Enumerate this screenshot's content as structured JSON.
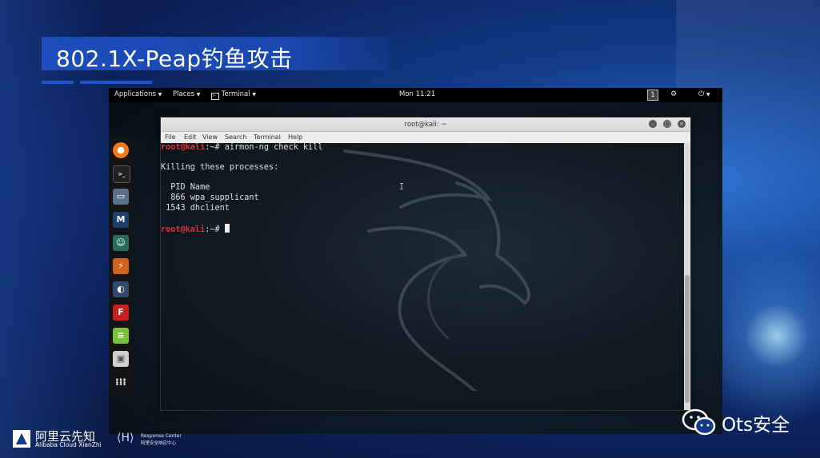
{
  "slide": {
    "title": "802.1X-Peap钓鱼攻击"
  },
  "topbar": {
    "applications": "Applications",
    "places": "Places",
    "terminal": "Terminal",
    "clock": "Mon 11:21",
    "workspace": "1"
  },
  "dock": {
    "items": [
      "firefox-icon",
      "terminal-icon",
      "files-icon",
      "metasploit-icon",
      "armitage-icon",
      "burpsuite-icon",
      "maltego-icon",
      "faraday-icon",
      "leafpad-icon",
      "cherrytree-icon",
      "app-grid-icon"
    ]
  },
  "terminal_window": {
    "title": "root@kali: ~",
    "menu": [
      "File",
      "Edit",
      "View",
      "Search",
      "Terminal",
      "Help"
    ],
    "lines": [
      {
        "user": "root@kali",
        "path": ":~# ",
        "cmd": "airmon-ng check kill"
      },
      {
        "text": "Killing these processes:"
      },
      {
        "text": "  PID Name"
      },
      {
        "text": "  866 wpa_supplicant"
      },
      {
        "text": " 1543 dhclient"
      },
      {
        "user": "root@kali",
        "path": ":~# ",
        "cmd": ""
      }
    ]
  },
  "footer": {
    "ali_cn": "阿里云先知",
    "ali_en": "Alibaba Cloud XianZhi",
    "response_en": "Response Center",
    "response_cn": "阿里安全响应中心",
    "watermark": "Ots安全"
  },
  "colors": {
    "prompt_user": "#e0323a",
    "title_bar": "#1c4dbb",
    "slide_bg": "#123a86"
  }
}
